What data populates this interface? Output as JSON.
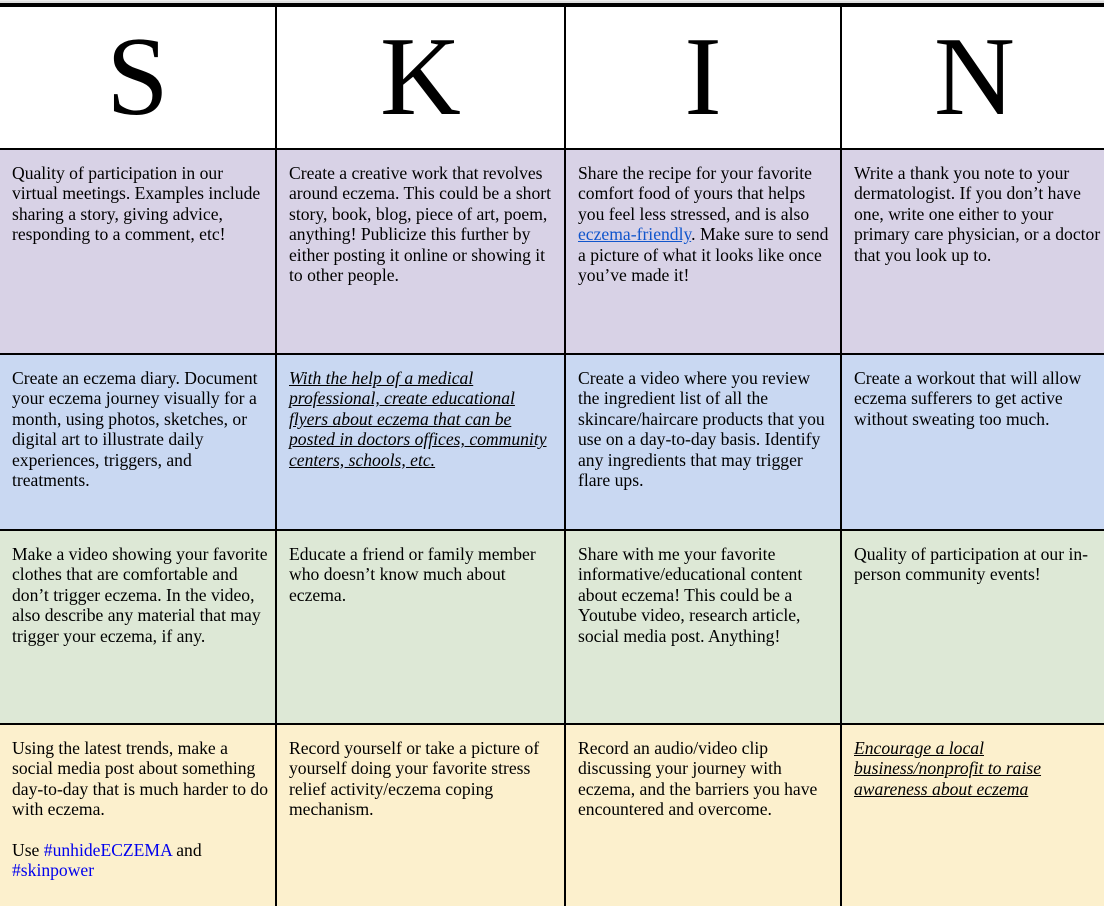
{
  "header": {
    "letters": [
      "S",
      "K",
      "I",
      "N"
    ]
  },
  "rows": [
    {
      "cells": [
        "Quality of participation in our virtual meetings. Examples include sharing a story, giving advice, responding to a comment, etc!",
        "Create a creative work that revolves around eczema. This could be a short story, book, blog, piece of art, poem, anything! Publicize this further by either posting it online or showing it to other people.",
        {
          "before": "Share the recipe for your favorite comfort food of yours that helps you feel less stressed, and is also ",
          "link": "eczema-friendly",
          "after": ". Make sure to send a picture of what it looks like once you’ve made it!"
        },
        "Write a thank you note to your dermatologist. If you don’t have one, write one either to your primary care physician, or a doctor that you look up to."
      ]
    },
    {
      "cells": [
        "Create an eczema diary. Document your eczema journey visually for a month, using photos, sketches, or digital art to illustrate daily experiences, triggers, and treatments.",
        "With the help of a medical professional, create educational flyers about eczema that can be posted in doctors offices, community centers, schools, etc.",
        "Create a video where you review the ingredient list of all the skincare/haircare products that you use on a day-to-day basis. Identify any ingredients that may trigger flare ups.",
        "Create a workout that will allow eczema sufferers to get active without sweating too much."
      ]
    },
    {
      "cells": [
        "Make a video showing your favorite clothes that are comfortable and don’t trigger eczema. In the video, also describe any material that may trigger your eczema, if any.",
        "Educate a friend or family member who doesn’t know much about eczema.",
        "Share with me your favorite informative/educational content about eczema! This could be a Youtube video, research article, social media post. Anything!",
        "Quality of participation at our in-person community events!"
      ]
    },
    {
      "cells": [
        {
          "text": "Using the latest trends, make a social media post about something day-to-day that is much harder to do with eczema.",
          "use_prefix": "Use ",
          "hashtag1": "#unhideECZEMA",
          "and": " and ",
          "hashtag2": "#skinpower"
        },
        "Record yourself or take a picture of yourself doing your favorite stress relief activity/eczema coping mechanism.",
        "Record an audio/video clip discussing your journey with eczema, and the barriers you have encountered and overcome.",
        "Encourage a local business/nonprofit to raise awareness about eczema"
      ]
    }
  ],
  "colors": {
    "row1": "#d8d2e6",
    "row2": "#c9d8f2",
    "row3": "#dde8d6",
    "row4": "#fcf0cd",
    "link": "#1155cc",
    "hashtag": "#0000ee"
  }
}
